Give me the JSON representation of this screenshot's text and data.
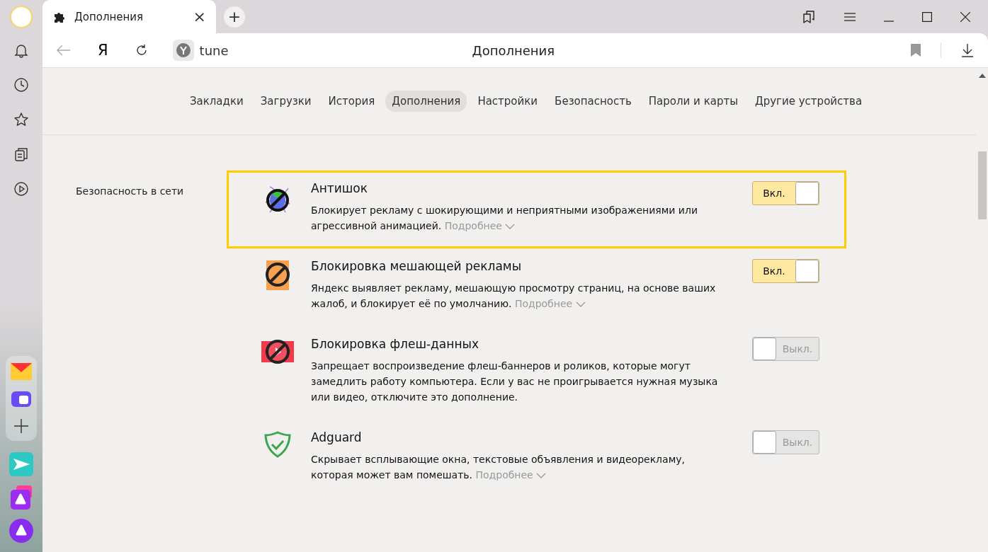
{
  "browser_tab": {
    "title": "Дополнения",
    "close": "×",
    "selected": true
  },
  "new_tab": "+",
  "address_bar": {
    "logo": "Я",
    "url": "tune",
    "page_title": "Дополнения"
  },
  "nav_tabs": [
    {
      "label": "Закладки",
      "selected": false
    },
    {
      "label": "Загрузки",
      "selected": false
    },
    {
      "label": "История",
      "selected": false
    },
    {
      "label": "Дополнения",
      "selected": true
    },
    {
      "label": "Настройки",
      "selected": false
    },
    {
      "label": "Безопасность",
      "selected": false
    },
    {
      "label": "Пароли и карты",
      "selected": false
    },
    {
      "label": "Другие устройства",
      "selected": false
    }
  ],
  "section": {
    "title": "Безопасность в сети",
    "extensions": [
      {
        "kind": "antishock",
        "title": "Антишок",
        "description": "Блокирует рекламу с шокирующими и неприятными изображениями или агрессивной анимацией.",
        "more": "Подробнее",
        "highlighted": true,
        "on": true,
        "toggle_label": "Вкл."
      },
      {
        "kind": "adblock",
        "title": "Блокировка мешающей рекламы",
        "description": "Яндекс выявляет рекламу, мешающую просмотру страниц, на основе ваших жалоб, и блокирует её по умолчанию.",
        "more": "Подробнее",
        "highlighted": false,
        "on": true,
        "toggle_label": "Вкл."
      },
      {
        "kind": "flash",
        "title": "Блокировка флеш-данных",
        "description": "Запрещает воспроизведение флеш-баннеров и роликов, которые могут замедлить работу компьютера. Если у вас не проигрывается нужная музыка или видео, отключите это дополнение.",
        "highlighted": false,
        "on": false,
        "toggle_label": "Выкл."
      },
      {
        "kind": "shield",
        "title": "Adguard",
        "description": "Скрывает всплывающие окна, текстовые объявления и видеорекламу, которая может вам помешать.",
        "more": "Подробнее",
        "highlighted": false,
        "on": false,
        "toggle_label": "Выкл."
      }
    ]
  }
}
